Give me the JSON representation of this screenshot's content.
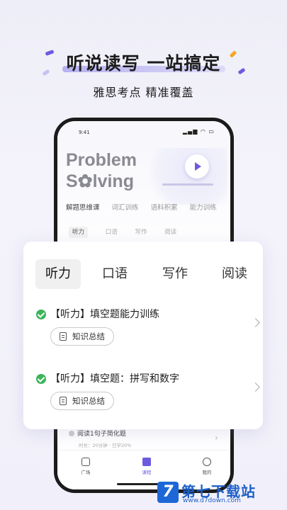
{
  "promo": {
    "headline": "听说读写 一站搞定",
    "subhead": "雅思考点 精准覆盖"
  },
  "phone": {
    "status_time": "9:41",
    "status_icons": "▂▄▆ ◠ ▭",
    "hero_title_line1": "Problem",
    "hero_title_line2": "S✿lving",
    "course_tabs": [
      "解题思维课",
      "词汇训练",
      "语料积累",
      "能力训练"
    ],
    "skill_tabs": [
      "听力",
      "口语",
      "写作",
      "阅读"
    ],
    "lower_item_title": "阅读1句子简化题",
    "lower_item_meta": "时长：20分钟 · 已学20%",
    "tabbar": [
      "广场",
      "课程",
      "我的"
    ]
  },
  "card": {
    "tabs": [
      "听力",
      "口语",
      "写作",
      "阅读"
    ],
    "active_tab": "听力",
    "lessons": [
      {
        "title": "【听力】填空题能力训练",
        "pill": "知识总结"
      },
      {
        "title": "【听力】填空题：拼写和数字",
        "pill": "知识总结"
      }
    ]
  },
  "watermark": {
    "logo": "7",
    "text": "第七下载站",
    "url": "www.d7down.com"
  },
  "colors": {
    "accent": "#6b5be0",
    "check": "#3ab55a",
    "watermark": "#1e5fc8"
  }
}
